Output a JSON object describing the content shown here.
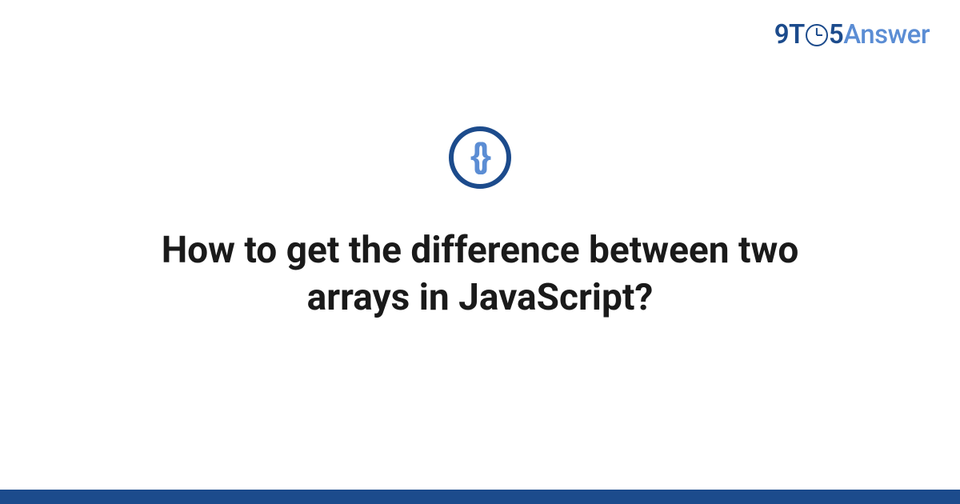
{
  "logo": {
    "part1": "9T",
    "part2": "5",
    "part3": "Answer"
  },
  "icon": {
    "name": "code-braces",
    "left": "{",
    "right": "}"
  },
  "title": "How to get the difference between two arrays in JavaScript?",
  "colors": {
    "primary": "#1c4b8c",
    "accent": "#5b8dd4"
  }
}
